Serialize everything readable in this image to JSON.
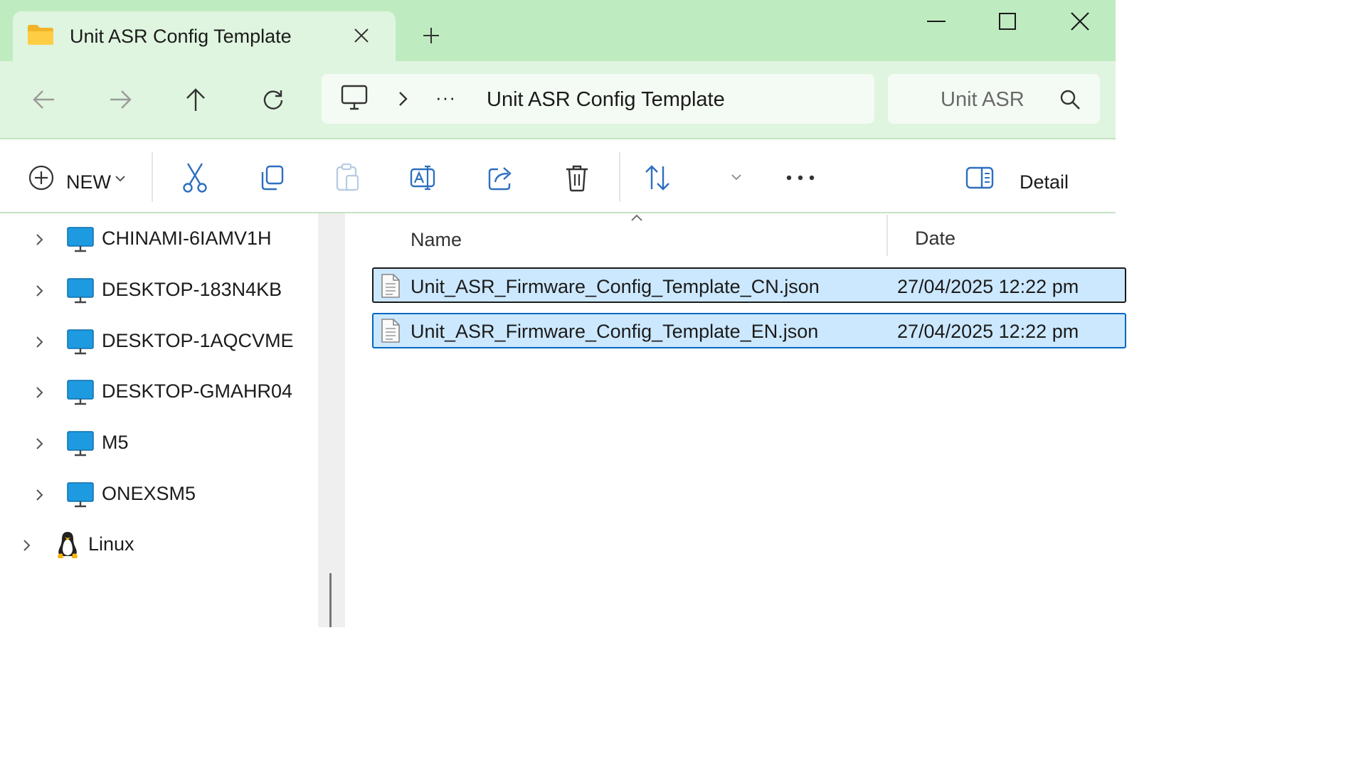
{
  "window": {
    "tab_title": "Unit ASR Config Template",
    "icons": {
      "tab": "folder-icon",
      "tab_close": "close-icon",
      "new_tab": "plus-icon",
      "minimize": "minimize-icon",
      "maximize": "maximize-icon",
      "close": "close-icon"
    }
  },
  "nav": {
    "ellipsis": "···",
    "current_folder": "Unit ASR Config Template",
    "search_text": "Unit ASR",
    "icons": [
      "back-arrow-icon",
      "forward-arrow-icon",
      "up-arrow-icon",
      "refresh-icon",
      "computer-icon",
      "chevron-right-icon",
      "search-icon"
    ]
  },
  "toolbar": {
    "new_label": "NEW",
    "details_label": "Detail",
    "icons": [
      "cut-icon",
      "copy-icon",
      "paste-icon",
      "rename-icon",
      "share-icon",
      "delete-icon",
      "sort-icon",
      "more-icon",
      "details-pane-icon"
    ]
  },
  "sidebar": {
    "items": [
      {
        "label": "CHINAMI-6IAMV1H",
        "icon": "computer-icon"
      },
      {
        "label": "DESKTOP-183N4KB",
        "icon": "computer-icon"
      },
      {
        "label": "DESKTOP-1AQCVME",
        "icon": "computer-icon"
      },
      {
        "label": "DESKTOP-GMAHR04",
        "icon": "computer-icon"
      },
      {
        "label": "M5",
        "icon": "computer-icon"
      },
      {
        "label": "ONEXSM5",
        "icon": "computer-icon"
      },
      {
        "label": "Linux",
        "icon": "linux-penguin-icon"
      }
    ]
  },
  "filelist": {
    "columns": {
      "name": "Name",
      "date": "Date"
    },
    "files": [
      {
        "name": "Unit_ASR_Firmware_Config_Template_CN.json",
        "date": "27/04/2025 12:22 pm",
        "selected": true
      },
      {
        "name": "Unit_ASR_Firmware_Config_Template_EN.json",
        "date": "27/04/2025 12:22 pm",
        "selected": true
      }
    ]
  },
  "colors": {
    "titlebar": "#bfebc0",
    "navbar": "#dff5df",
    "selection": "#cce8ff",
    "selection_border": "#0067c0",
    "pc_icon": "#1e9be0"
  }
}
